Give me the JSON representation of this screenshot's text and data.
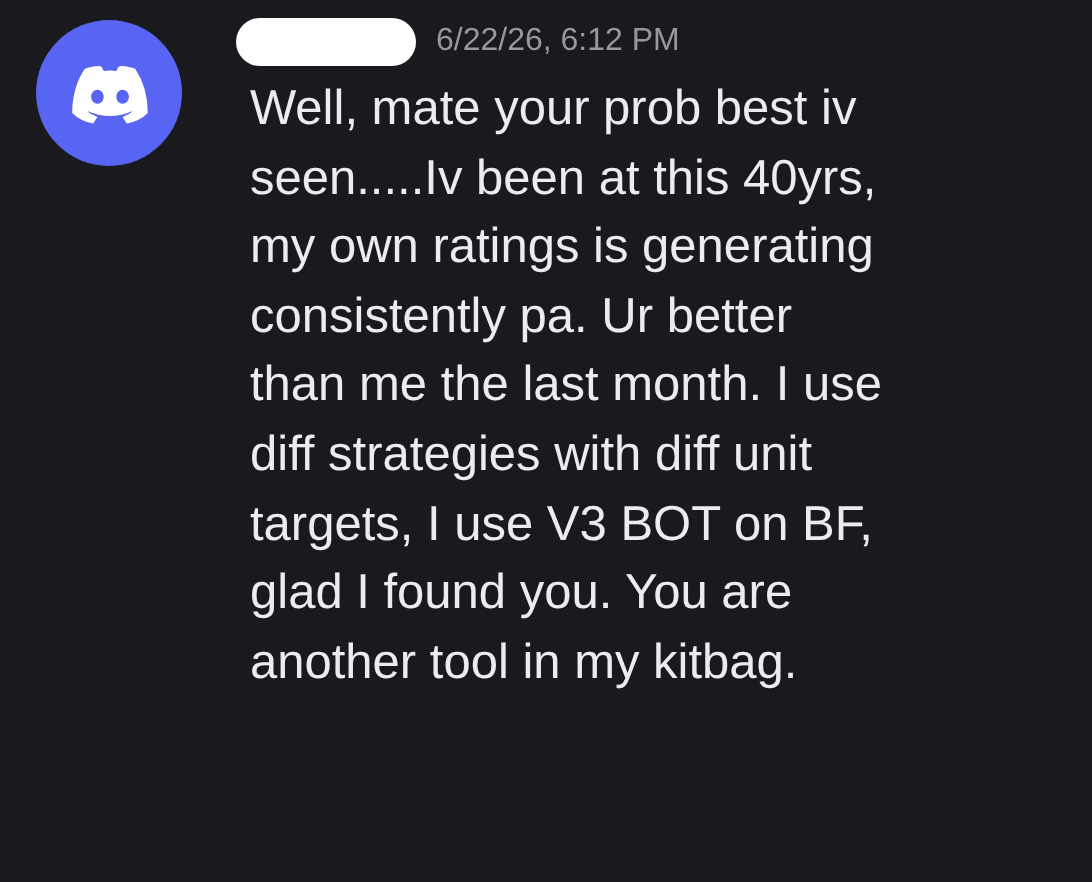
{
  "message": {
    "timestamp": "6/22/26, 6:12 PM",
    "lines": [
      "Well, mate your prob best iv",
      "seen.....Iv been at this 40yrs,",
      "my own ratings is generating",
      "consistently pa. Ur better",
      "than me the last month. I use",
      "diff strategies with diff unit",
      "targets, I use V3 BOT on BF,",
      "glad I found you. You are",
      "another tool in my kitbag."
    ]
  }
}
